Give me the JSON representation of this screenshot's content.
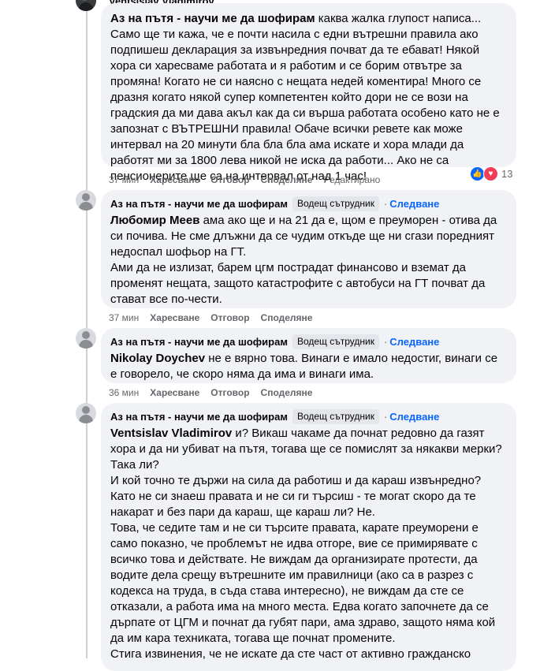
{
  "comments": [
    {
      "top_name": "Ventsislav Vladimirov",
      "group": "Аз на пътя - научи ме да шофирам",
      "text": " каква жалка глупост написа... Само ще ти кажа, че е почти насила с едни вътрешни правила ако подпишеш декларация за извънредния почват да те ебават! Някой хора си харесваме работата и я работим и се борим отвътре за промяна! Когато не си наясно с нещата недей коментира! Много се дразня когато някой супер компетентен който дори не се вози на градския да ми дава акъл как да си върша работата особено като не е запознат с ВЪТРЕШНИ правила! Обаче всички ревете как може интервал на 20 минути бла бла бла ама искате и хора млади да работят ми за 1800 лева никой не иска да работи... Ако не са пенсионерите ще са на интервал от над 1 час!",
      "time": "37 мин",
      "like": "Харесване",
      "reply": "Отговор",
      "share": "Споделяне",
      "edited": "Редактирано",
      "reaction_count": "13"
    },
    {
      "author": "Аз на пътя - научи ме да шофирам",
      "badge": "Водещ сътрудник",
      "follow": "Следване",
      "mention": "Любомир Меев",
      "text1": " ама ако ще и на 21 да е, щом е преуморен - отива да си почива. Не сме длъжни да се чудим откъде ще ни сгази поредният недоспал шофьор на ГТ.",
      "text2": "Ами да не излизат, барем цгм пострадат финансово и вземат да променят нещата, защото катастрофите с автобуси на ГТ почват да стават все по-чести.",
      "time": "37 мин",
      "like": "Харесване",
      "reply": "Отговор",
      "share": "Споделяне"
    },
    {
      "author": "Аз на пътя - научи ме да шофирам",
      "badge": "Водещ сътрудник",
      "follow": "Следване",
      "mention": "Nikolay Doychev",
      "text1": " не е вярно това. Винаги е имало недостиг, винаги се е говорело, че скоро няма да има и винаги има.",
      "time": "36 мин",
      "like": "Харесване",
      "reply": "Отговор",
      "share": "Споделяне"
    },
    {
      "author": "Аз на пътя - научи ме да шофирам",
      "badge": "Водещ сътрудник",
      "follow": "Следване",
      "mention": "Ventsislav Vladimirov",
      "text1": " и? Викаш чакаме да почнат редовно да газят хора и да ни убиват на пътя, тогава ще се помислят за някакви мерки? Така ли?",
      "text2": "И кой точно те държи на сила да работиш и да караш извънредно? Като не си знаеш правата и не си ги търсиш - те могат скоро да те накарат и без пари да караш, ще караш ли? Не.",
      "text3": "Това, че седите там и не си търсите правата, карате преуморени е само показно, че проблемът не идва отгоре, вие се примирявате с всичко това и действате. Не виждам да организирате протести, да водите дела срещу вътрешните им правилници (ако са в разрез с кодекса на труда, в съда става интересно), не виждам да сте се отказали, а работа има на много места. Едва когато започнете да се дърпате от ЦГМ и почнат да губят пари, ама здраво, защото няма кой да им кара техниката, тогава ще почнат промените.",
      "text4": "Стига извинения, че не искате да сте част от активно гражданско"
    }
  ]
}
